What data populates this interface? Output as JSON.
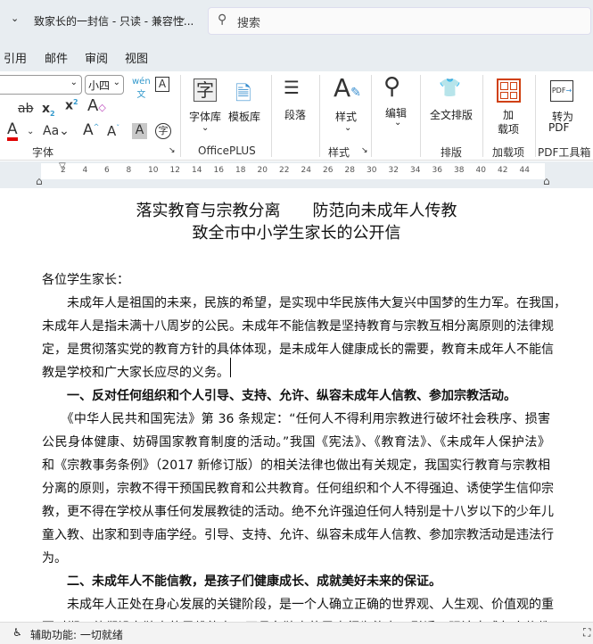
{
  "titlebar": {
    "doc_title": "致家长的一封信 - 只读 - 兼容性...",
    "search_placeholder": "搜索"
  },
  "tabs": [
    "引用",
    "邮件",
    "审阅",
    "视图"
  ],
  "ribbon": {
    "font_size": "小四",
    "font_group": "字体",
    "officeplus": {
      "font_lib": "字体库",
      "template_lib": "模板库",
      "group": "OfficePLUS"
    },
    "paragraph": "段落",
    "styles": {
      "label": "样式",
      "group": "样式"
    },
    "edit": "编辑",
    "layout": {
      "label": "全文排版",
      "group": "排版"
    },
    "addins": {
      "label1": "加",
      "label2": "载项",
      "group": "加载项"
    },
    "pdf": {
      "label1": "转为",
      "label2": "PDF",
      "group": "PDF工具箱"
    },
    "accent_red": "#e00000"
  },
  "ruler": [
    "2",
    "4",
    "6",
    "8",
    "10",
    "12",
    "14",
    "16",
    "18",
    "20",
    "22",
    "24",
    "26",
    "28",
    "30",
    "32",
    "34",
    "36",
    "38",
    "40",
    "42",
    "44"
  ],
  "document": {
    "title1": "落实教育与宗教分离　　防范向未成年人传教",
    "title2": "致全市中小学生家长的公开信",
    "lines": [
      {
        "text": "各位学生家长：",
        "style": "end"
      },
      {
        "text": "　　未成年人是祖国的未来，民族的希望，是实现中华民族伟大复兴中国梦的生力军。在我国，",
        "style": ""
      },
      {
        "text": "未成年人是指未满十八周岁的公民。未成年不能信教是坚持教育与宗教互相分离原则的法律规",
        "style": ""
      },
      {
        "text": "定，是贯彻落实党的教育方针的具体体现，是未成年人健康成长的需要，教育未成年人不能信",
        "style": ""
      },
      {
        "text": "教是学校和广大家长应尽的义务。",
        "style": "end"
      },
      {
        "text": "　　一、反对任何组织和个人引导、支持、允许、纵容未成年人信教、参加宗教活动。",
        "style": "end b"
      },
      {
        "text": "　　《中华人民共和国宪法》第 36 条规定：“任何人不得利用宗教进行破坏社会秩序、损害",
        "style": ""
      },
      {
        "text": "公民身体健康、妨碍国家教育制度的活动。”我国《宪法》、《教育法》、《未成年人保护法》",
        "style": ""
      },
      {
        "text": "和《宗教事务条例》（2017 新修订版）的相关法律也做出有关规定，我国实行教育与宗教相",
        "style": ""
      },
      {
        "text": "分离的原则，宗教不得干预国民教育和公共教育。任何组织和个人不得强迫、诱使学生信仰宗",
        "style": ""
      },
      {
        "text": "教，更不得在学校从事任何发展教徒的活动。绝不允许强迫任何人特别是十八岁以下的少年儿",
        "style": ""
      },
      {
        "text": "童入教、出家和到寺庙学经。引导、支持、允许、纵容未成年人信教、参加宗教活动是违法行",
        "style": ""
      },
      {
        "text": "为。",
        "style": "end"
      },
      {
        "text": "　　二、未成年人不能信教，是孩子们健康成长、成就美好未来的保证。",
        "style": "end b"
      },
      {
        "text": "　　未成年人正处在身心发展的关键阶段，是一个人确立正确的世界观、人生观、价值观的重",
        "style": ""
      },
      {
        "text": "要时期，他们没有独立的思维能力，不具备独立的民事行为能力，引诱、强迫未成年人信教",
        "style": ""
      }
    ]
  },
  "status": {
    "accessibility": "辅助功能: 一切就绪"
  }
}
